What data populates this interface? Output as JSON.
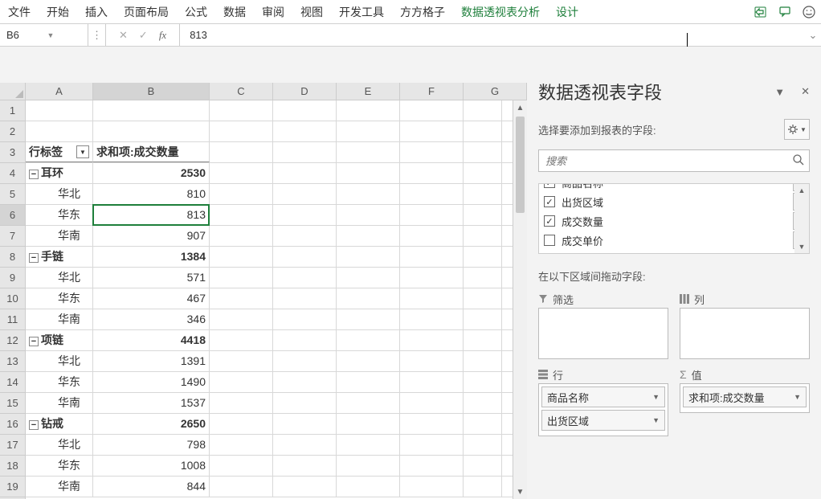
{
  "ribbon": {
    "items": [
      "文件",
      "开始",
      "插入",
      "页面布局",
      "公式",
      "数据",
      "审阅",
      "视图",
      "开发工具",
      "方方格子",
      "数据透视表分析",
      "设计"
    ]
  },
  "namebox": "B6",
  "formula": "813",
  "columns": [
    "A",
    "B",
    "C",
    "D",
    "E",
    "F",
    "G"
  ],
  "activeCell": {
    "row": 6,
    "col": "B"
  },
  "pivotHeaders": {
    "rowLabel": "行标签",
    "valueLabel": "求和项:成交数量"
  },
  "chart_data": {
    "type": "table",
    "title": "求和项:成交数量 by 商品名称 / 出货区域",
    "row_field": "商品名称",
    "sub_row_field": "出货区域",
    "value_field": "成交数量",
    "groups": [
      {
        "name": "耳环",
        "total": 2530,
        "children": [
          {
            "name": "华北",
            "value": 810
          },
          {
            "name": "华东",
            "value": 813
          },
          {
            "name": "华南",
            "value": 907
          }
        ]
      },
      {
        "name": "手链",
        "total": 1384,
        "children": [
          {
            "name": "华北",
            "value": 571
          },
          {
            "name": "华东",
            "value": 467
          },
          {
            "name": "华南",
            "value": 346
          }
        ]
      },
      {
        "name": "项链",
        "total": 4418,
        "children": [
          {
            "name": "华北",
            "value": 1391
          },
          {
            "name": "华东",
            "value": 1490
          },
          {
            "name": "华南",
            "value": 1537
          }
        ]
      },
      {
        "name": "钻戒",
        "total": 2650,
        "children": [
          {
            "name": "华北",
            "value": 798
          },
          {
            "name": "华东",
            "value": 1008
          },
          {
            "name": "华南",
            "value": 844
          }
        ]
      }
    ]
  },
  "pivotPanel": {
    "title": "数据透视表字段",
    "chooseLabel": "选择要添加到报表的字段:",
    "searchPlaceholder": "搜索",
    "fields": [
      {
        "name": "商品名称",
        "checked": true,
        "cut": true
      },
      {
        "name": "出货区域",
        "checked": true
      },
      {
        "name": "成交数量",
        "checked": true
      },
      {
        "name": "成交单价",
        "checked": false
      }
    ],
    "dragLabel": "在以下区域间拖动字段:",
    "areas": {
      "filter": {
        "label": "筛选",
        "items": []
      },
      "columns": {
        "label": "列",
        "items": []
      },
      "rows": {
        "label": "行",
        "items": [
          "商品名称",
          "出货区域"
        ]
      },
      "values": {
        "label": "值",
        "items": [
          "求和项:成交数量"
        ]
      }
    }
  }
}
